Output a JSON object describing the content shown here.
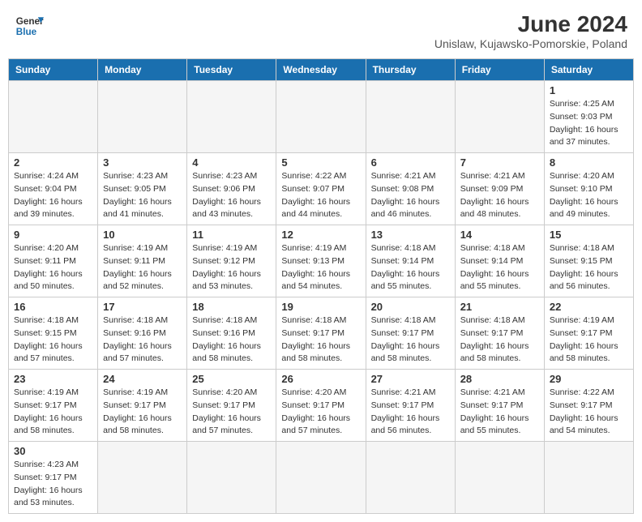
{
  "header": {
    "logo_general": "General",
    "logo_blue": "Blue",
    "title": "June 2024",
    "subtitle": "Unislaw, Kujawsko-Pomorskie, Poland"
  },
  "weekdays": [
    "Sunday",
    "Monday",
    "Tuesday",
    "Wednesday",
    "Thursday",
    "Friday",
    "Saturday"
  ],
  "days": [
    {
      "date": "",
      "info": ""
    },
    {
      "date": "",
      "info": ""
    },
    {
      "date": "",
      "info": ""
    },
    {
      "date": "",
      "info": ""
    },
    {
      "date": "",
      "info": ""
    },
    {
      "date": "",
      "info": ""
    },
    {
      "date": "1",
      "sunrise": "Sunrise: 4:25 AM",
      "sunset": "Sunset: 9:03 PM",
      "daylight": "Daylight: 16 hours and 37 minutes."
    },
    {
      "date": "2",
      "sunrise": "Sunrise: 4:24 AM",
      "sunset": "Sunset: 9:04 PM",
      "daylight": "Daylight: 16 hours and 39 minutes."
    },
    {
      "date": "3",
      "sunrise": "Sunrise: 4:23 AM",
      "sunset": "Sunset: 9:05 PM",
      "daylight": "Daylight: 16 hours and 41 minutes."
    },
    {
      "date": "4",
      "sunrise": "Sunrise: 4:23 AM",
      "sunset": "Sunset: 9:06 PM",
      "daylight": "Daylight: 16 hours and 43 minutes."
    },
    {
      "date": "5",
      "sunrise": "Sunrise: 4:22 AM",
      "sunset": "Sunset: 9:07 PM",
      "daylight": "Daylight: 16 hours and 44 minutes."
    },
    {
      "date": "6",
      "sunrise": "Sunrise: 4:21 AM",
      "sunset": "Sunset: 9:08 PM",
      "daylight": "Daylight: 16 hours and 46 minutes."
    },
    {
      "date": "7",
      "sunrise": "Sunrise: 4:21 AM",
      "sunset": "Sunset: 9:09 PM",
      "daylight": "Daylight: 16 hours and 48 minutes."
    },
    {
      "date": "8",
      "sunrise": "Sunrise: 4:20 AM",
      "sunset": "Sunset: 9:10 PM",
      "daylight": "Daylight: 16 hours and 49 minutes."
    },
    {
      "date": "9",
      "sunrise": "Sunrise: 4:20 AM",
      "sunset": "Sunset: 9:11 PM",
      "daylight": "Daylight: 16 hours and 50 minutes."
    },
    {
      "date": "10",
      "sunrise": "Sunrise: 4:19 AM",
      "sunset": "Sunset: 9:11 PM",
      "daylight": "Daylight: 16 hours and 52 minutes."
    },
    {
      "date": "11",
      "sunrise": "Sunrise: 4:19 AM",
      "sunset": "Sunset: 9:12 PM",
      "daylight": "Daylight: 16 hours and 53 minutes."
    },
    {
      "date": "12",
      "sunrise": "Sunrise: 4:19 AM",
      "sunset": "Sunset: 9:13 PM",
      "daylight": "Daylight: 16 hours and 54 minutes."
    },
    {
      "date": "13",
      "sunrise": "Sunrise: 4:18 AM",
      "sunset": "Sunset: 9:14 PM",
      "daylight": "Daylight: 16 hours and 55 minutes."
    },
    {
      "date": "14",
      "sunrise": "Sunrise: 4:18 AM",
      "sunset": "Sunset: 9:14 PM",
      "daylight": "Daylight: 16 hours and 55 minutes."
    },
    {
      "date": "15",
      "sunrise": "Sunrise: 4:18 AM",
      "sunset": "Sunset: 9:15 PM",
      "daylight": "Daylight: 16 hours and 56 minutes."
    },
    {
      "date": "16",
      "sunrise": "Sunrise: 4:18 AM",
      "sunset": "Sunset: 9:15 PM",
      "daylight": "Daylight: 16 hours and 57 minutes."
    },
    {
      "date": "17",
      "sunrise": "Sunrise: 4:18 AM",
      "sunset": "Sunset: 9:16 PM",
      "daylight": "Daylight: 16 hours and 57 minutes."
    },
    {
      "date": "18",
      "sunrise": "Sunrise: 4:18 AM",
      "sunset": "Sunset: 9:16 PM",
      "daylight": "Daylight: 16 hours and 58 minutes."
    },
    {
      "date": "19",
      "sunrise": "Sunrise: 4:18 AM",
      "sunset": "Sunset: 9:17 PM",
      "daylight": "Daylight: 16 hours and 58 minutes."
    },
    {
      "date": "20",
      "sunrise": "Sunrise: 4:18 AM",
      "sunset": "Sunset: 9:17 PM",
      "daylight": "Daylight: 16 hours and 58 minutes."
    },
    {
      "date": "21",
      "sunrise": "Sunrise: 4:18 AM",
      "sunset": "Sunset: 9:17 PM",
      "daylight": "Daylight: 16 hours and 58 minutes."
    },
    {
      "date": "22",
      "sunrise": "Sunrise: 4:19 AM",
      "sunset": "Sunset: 9:17 PM",
      "daylight": "Daylight: 16 hours and 58 minutes."
    },
    {
      "date": "23",
      "sunrise": "Sunrise: 4:19 AM",
      "sunset": "Sunset: 9:17 PM",
      "daylight": "Daylight: 16 hours and 58 minutes."
    },
    {
      "date": "24",
      "sunrise": "Sunrise: 4:19 AM",
      "sunset": "Sunset: 9:17 PM",
      "daylight": "Daylight: 16 hours and 58 minutes."
    },
    {
      "date": "25",
      "sunrise": "Sunrise: 4:20 AM",
      "sunset": "Sunset: 9:17 PM",
      "daylight": "Daylight: 16 hours and 57 minutes."
    },
    {
      "date": "26",
      "sunrise": "Sunrise: 4:20 AM",
      "sunset": "Sunset: 9:17 PM",
      "daylight": "Daylight: 16 hours and 57 minutes."
    },
    {
      "date": "27",
      "sunrise": "Sunrise: 4:21 AM",
      "sunset": "Sunset: 9:17 PM",
      "daylight": "Daylight: 16 hours and 56 minutes."
    },
    {
      "date": "28",
      "sunrise": "Sunrise: 4:21 AM",
      "sunset": "Sunset: 9:17 PM",
      "daylight": "Daylight: 16 hours and 55 minutes."
    },
    {
      "date": "29",
      "sunrise": "Sunrise: 4:22 AM",
      "sunset": "Sunset: 9:17 PM",
      "daylight": "Daylight: 16 hours and 54 minutes."
    },
    {
      "date": "30",
      "sunrise": "Sunrise: 4:23 AM",
      "sunset": "Sunset: 9:17 PM",
      "daylight": "Daylight: 16 hours and 53 minutes."
    }
  ]
}
